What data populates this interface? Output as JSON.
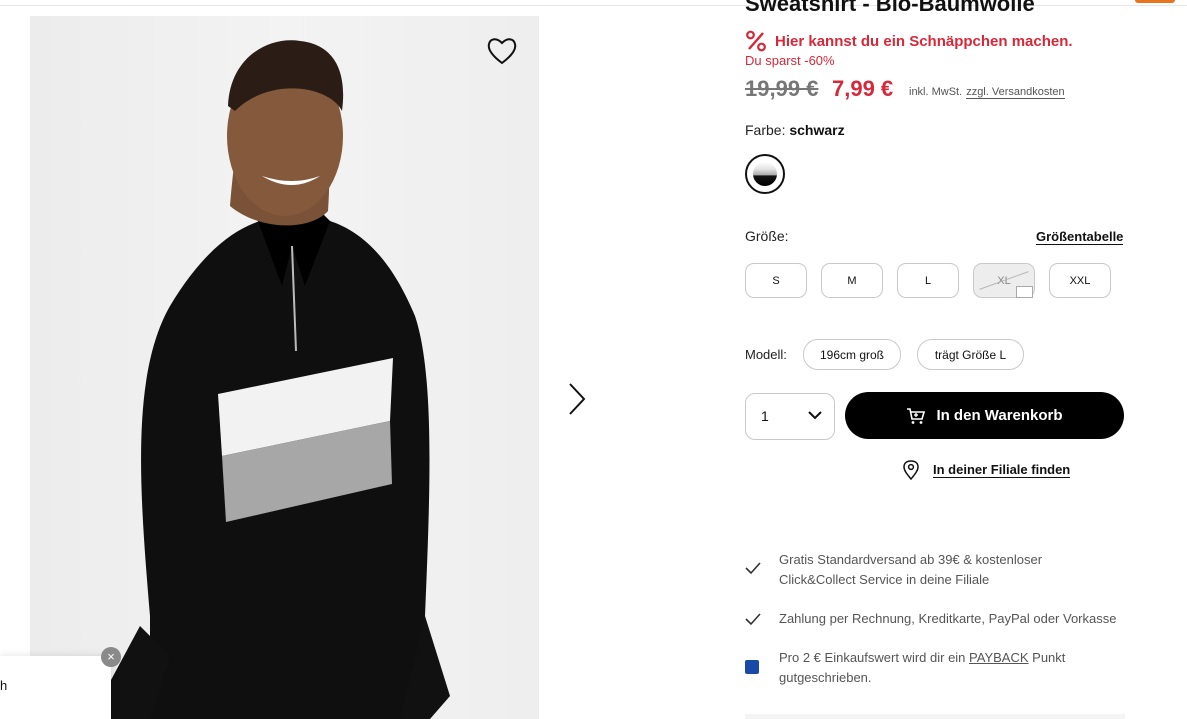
{
  "product": {
    "title": "Sweatshirt - Bio-Baumwolle",
    "deal_text": "Hier kannst du ein Schnäppchen machen.",
    "savings_text": "Du sparst -60%",
    "old_price": "19,99 €",
    "new_price": "7,99 €",
    "vat_text": "inkl. MwSt.",
    "shipping_link": "zzgl. Versandkosten"
  },
  "color": {
    "label": "Farbe:",
    "value": "schwarz"
  },
  "size": {
    "label": "Größe:",
    "table_link": "Größentabelle",
    "options": [
      "S",
      "M",
      "L",
      "XL",
      "XXL"
    ],
    "unavailable": [
      "XL"
    ]
  },
  "model": {
    "label": "Modell:",
    "height": "196cm groß",
    "size_worn": "trägt Größe L"
  },
  "purchase": {
    "quantity": "1",
    "add_to_cart": "In den Warenkorb",
    "find_store": "In deiner Filiale finden"
  },
  "benefits": {
    "shipping_line1": "Gratis Standardversand ab 39€ & kostenloser",
    "shipping_line2": "Click&Collect Service in deine Filiale",
    "payment": "Zahlung per Rechnung, Kreditkarte, PayPal oder Vorkasse",
    "payback_before": "Pro 2 € Einkaufswert wird dir ein",
    "payback_link": "PAYBACK",
    "payback_after": "Punkt",
    "payback_line2": "gutgeschrieben."
  },
  "popup": {
    "text": "h",
    "close": "×"
  },
  "colors": {
    "sale_red": "#d7283a",
    "cta_black": "#000000",
    "payback_blue": "#1a4aa8",
    "top_accent": "#e8741f"
  },
  "icons": [
    "heart-icon",
    "chevron-right-icon",
    "percent-icon",
    "cart-icon",
    "location-pin-icon",
    "checkmark-icon",
    "payback-icon",
    "chevron-down-icon",
    "close-icon"
  ]
}
